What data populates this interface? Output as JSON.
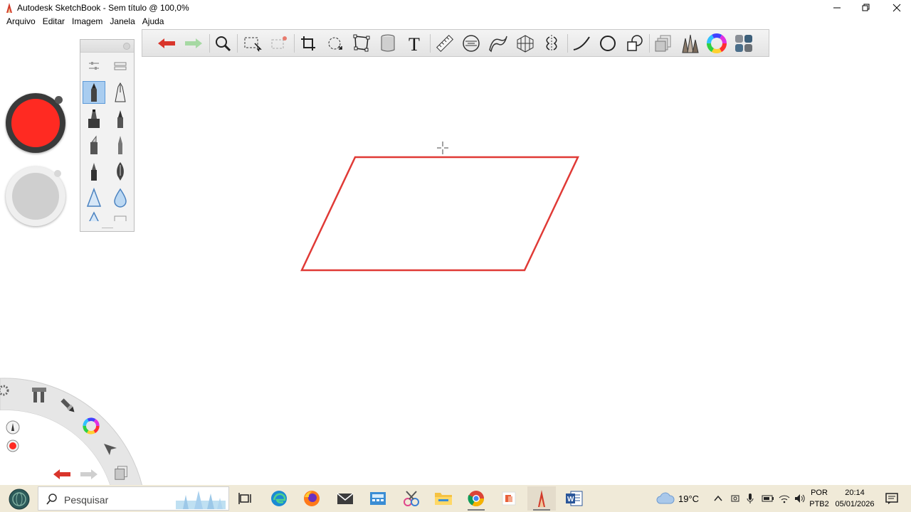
{
  "window": {
    "title": "Autodesk SketchBook - Sem título @ 100,0%",
    "controls": [
      "minimize-icon",
      "restore-icon",
      "close-icon"
    ]
  },
  "menu": {
    "items": [
      "Arquivo",
      "Editar",
      "Imagem",
      "Janela",
      "Ajuda"
    ]
  },
  "toolbar": {
    "tools": [
      "undo-icon",
      "redo-icon",
      "zoom-icon",
      "select-icon",
      "select-layer-icon",
      "crop-icon",
      "transform-icon",
      "distort-icon",
      "fill-bucket-icon",
      "text-icon",
      "ruler-icon",
      "ellipse-guide-icon",
      "french-curve-icon",
      "perspective-icon",
      "symmetry-icon",
      "stroke-line-icon",
      "ellipse-icon",
      "shapes-icon",
      "layers-icon",
      "brush-library-icon",
      "color-wheel-icon",
      "copic-library-icon"
    ]
  },
  "brush_palette": {
    "brushes": [
      "pencil",
      "ink-pen",
      "marker",
      "paintbrush",
      "chisel-marker",
      "airbrush-pen",
      "ballpoint",
      "fountain-pen",
      "smudge",
      "water-drop"
    ]
  },
  "colors": {
    "primary_color": "#ff2a22",
    "secondary_color": "#cfcfcf",
    "stroke_color": "#e03a36"
  },
  "lagoon": {
    "items": [
      "tools-icon",
      "brush-icon",
      "color-wheel-icon",
      "select-arrow-icon",
      "undo-icon",
      "redo-icon",
      "layers-icon",
      "brush-size-icon",
      "color-dot-icon"
    ]
  },
  "taskbar": {
    "search_placeholder": "Pesquisar",
    "apps": [
      "task-view-icon",
      "edge-icon",
      "firefox-icon",
      "mail-icon",
      "calculator-icon",
      "snipping-icon",
      "file-explorer-icon",
      "chrome-icon",
      "office-icon",
      "sketchbook-icon",
      "word-icon"
    ],
    "weather": "19°C",
    "lang_line1": "POR",
    "lang_line2": "PTB2",
    "time": "20:14",
    "date": "05/01/2026"
  }
}
